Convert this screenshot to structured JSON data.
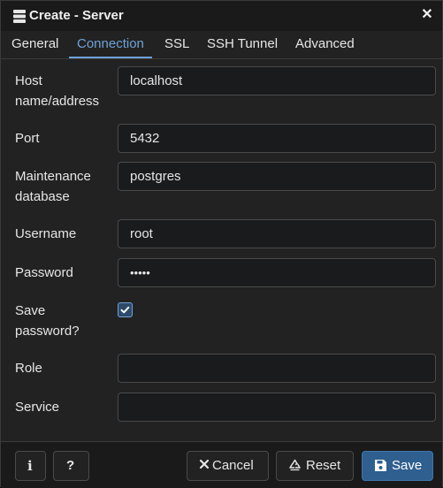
{
  "dialog": {
    "title": "Create - Server",
    "close_glyph": "✕"
  },
  "tabs": [
    {
      "label": "General",
      "active": false
    },
    {
      "label": "Connection",
      "active": true
    },
    {
      "label": "SSL",
      "active": false
    },
    {
      "label": "SSH Tunnel",
      "active": false
    },
    {
      "label": "Advanced",
      "active": false
    }
  ],
  "form": {
    "host": {
      "label_line1": "Host",
      "label_line2": "name/address",
      "value": "localhost"
    },
    "port": {
      "label": "Port",
      "value": "5432"
    },
    "maintenance_db": {
      "label_line1": "Maintenance",
      "label_line2": "database",
      "value": "postgres"
    },
    "username": {
      "label": "Username",
      "value": "root"
    },
    "password": {
      "label": "Password",
      "value": "•••••"
    },
    "save_password": {
      "label_line1": "Save",
      "label_line2": "password?",
      "checked": true
    },
    "role": {
      "label": "Role",
      "value": ""
    },
    "service": {
      "label": "Service",
      "value": ""
    }
  },
  "footer": {
    "info_glyph": "i",
    "help_glyph": "?",
    "cancel_label": "Cancel",
    "reset_label": "Reset",
    "save_label": "Save"
  },
  "colors": {
    "accent": "#6fa3d8",
    "primary_button": "#2f5f8f",
    "background": "#222222"
  }
}
